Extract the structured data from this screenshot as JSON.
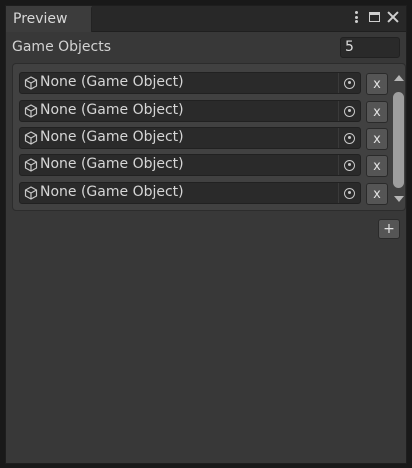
{
  "window": {
    "tab_label": "Preview"
  },
  "field": {
    "label": "Game Objects",
    "value": "5"
  },
  "list": {
    "items": [
      {
        "label": "None (Game Object)",
        "remove_label": "x"
      },
      {
        "label": "None (Game Object)",
        "remove_label": "x"
      },
      {
        "label": "None (Game Object)",
        "remove_label": "x"
      },
      {
        "label": "None (Game Object)",
        "remove_label": "x"
      },
      {
        "label": "None (Game Object)",
        "remove_label": "x"
      }
    ],
    "add_label": "+"
  },
  "icons": {
    "menu": "more-vertical-icon",
    "maximize": "maximize-icon",
    "close": "close-icon",
    "object": "cube-icon",
    "picker": "object-picker-icon"
  }
}
